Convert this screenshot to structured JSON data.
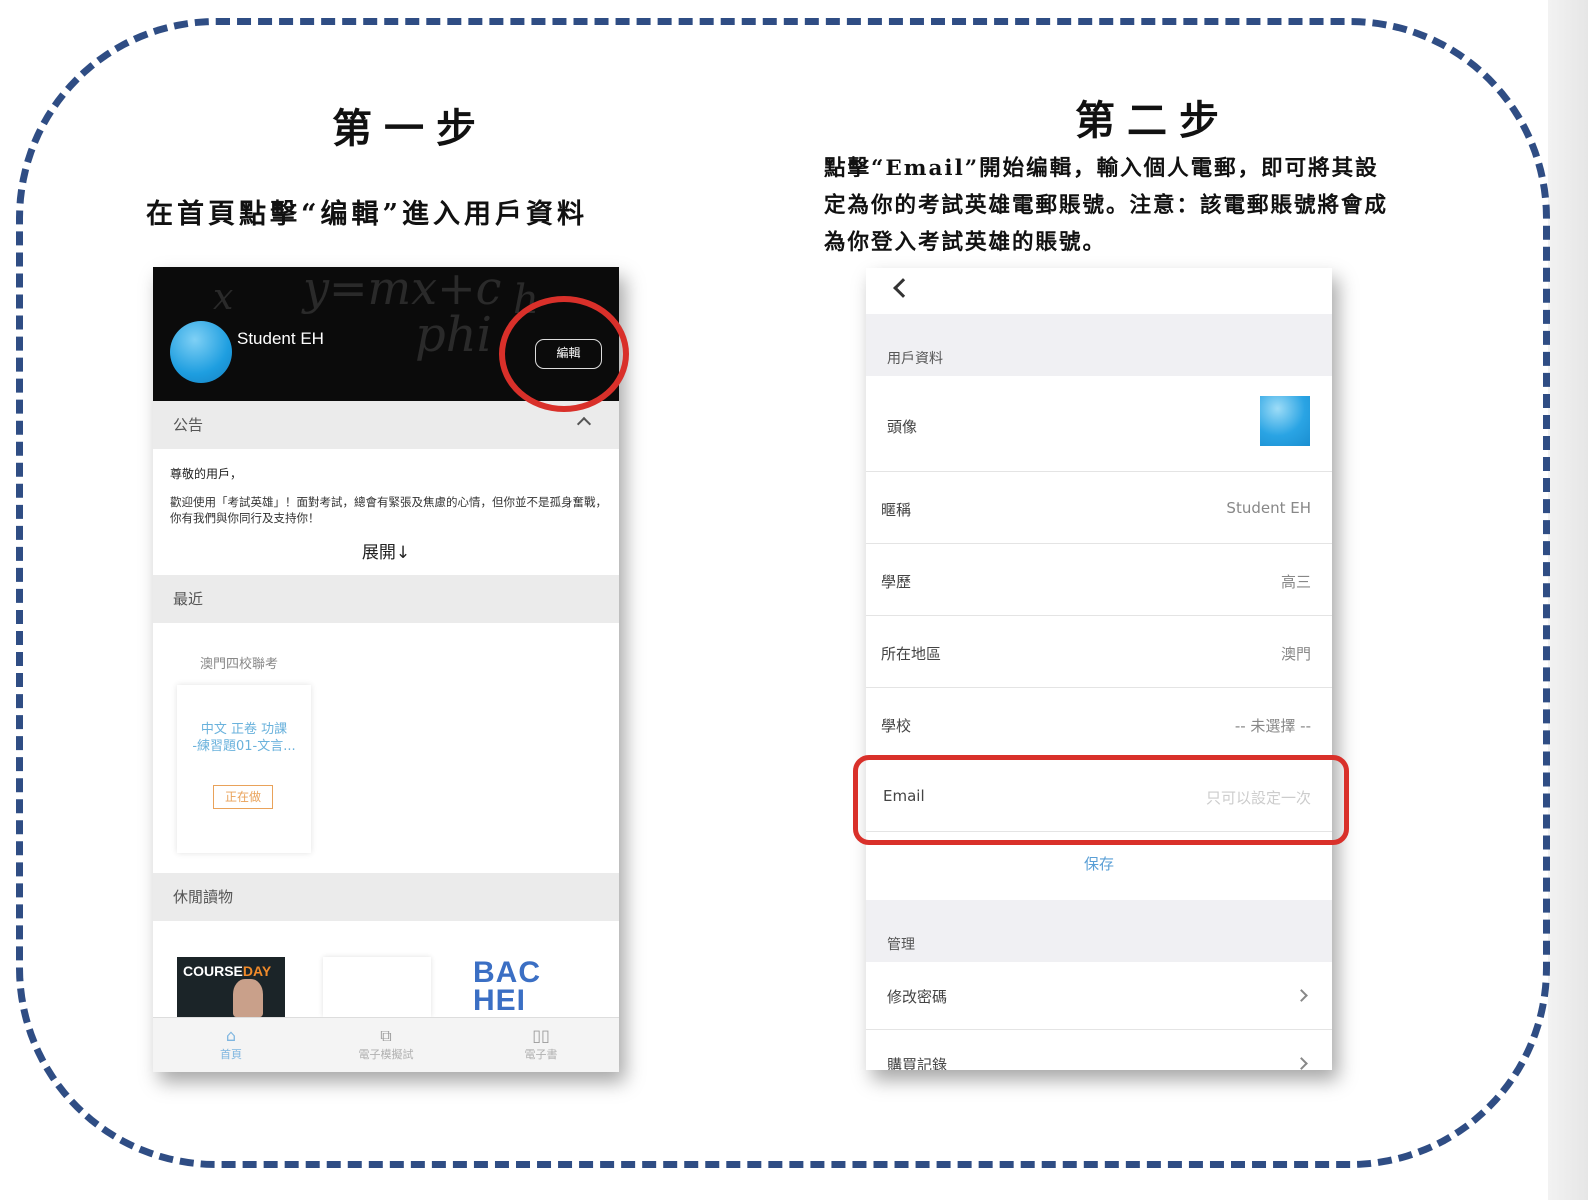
{
  "step1": {
    "heading": "第一步",
    "instruction": "在首頁點擊“编輯”進入用戶資料"
  },
  "step2": {
    "heading": "第二步",
    "instruction_lines": [
      "點擊“Email”開始编輯，輸入個人電郵，即可將其設",
      "定為你的考試英雄電郵賬號。注意：該電郵賬號將會成",
      "為你登入考試英雄的賬號。"
    ]
  },
  "home": {
    "chalk_text": [
      "y=mx+c",
      "phi",
      "h",
      "x"
    ],
    "username": "Student EH",
    "edit_label": "編輯",
    "announcement": {
      "title": "公告",
      "greeting": "尊敬的用戶，",
      "body": "歡迎使用「考試英雄」！面對考試，總會有緊張及焦慮的心情，但你並不是孤身奮戰，你有我們與你同行及支持你！",
      "expand_label": "展開↓"
    },
    "recent": {
      "title": "最近",
      "exam_name": "澳門四校聯考",
      "card_title": "中文 正卷 功課\n-練習題01-文言...",
      "status": "正在做"
    },
    "leisure": {
      "title": "休閒讀物",
      "book1_brand": "COURSE",
      "book1_brand_accent": "DAY",
      "book3_text": [
        "BAC",
        "HEI"
      ]
    },
    "tabs": [
      {
        "icon": "⌂",
        "label": "首頁"
      },
      {
        "icon": "⧉",
        "label": "電子模擬試"
      },
      {
        "icon": "▯▯",
        "label": "電子書"
      }
    ]
  },
  "profile": {
    "section_title": "用戶資料",
    "rows": [
      {
        "label": "頭像",
        "value": ""
      },
      {
        "label": "暱稱",
        "value": "Student EH"
      },
      {
        "label": "學歷",
        "value": "高三"
      },
      {
        "label": "所在地區",
        "value": "澳門"
      },
      {
        "label": "學校",
        "value": "-- 未選擇 --"
      }
    ],
    "email": {
      "label": "Email",
      "placeholder": "只可以設定一次"
    },
    "save_label": "保存",
    "manage_title": "管理",
    "manage_items": [
      {
        "label": "修改密碼"
      },
      {
        "label": "購買記錄"
      }
    ]
  },
  "colors": {
    "frame": "#2f4d84",
    "highlight": "#d9302a",
    "link": "#5a9fd6",
    "status": "#e9a25a"
  }
}
